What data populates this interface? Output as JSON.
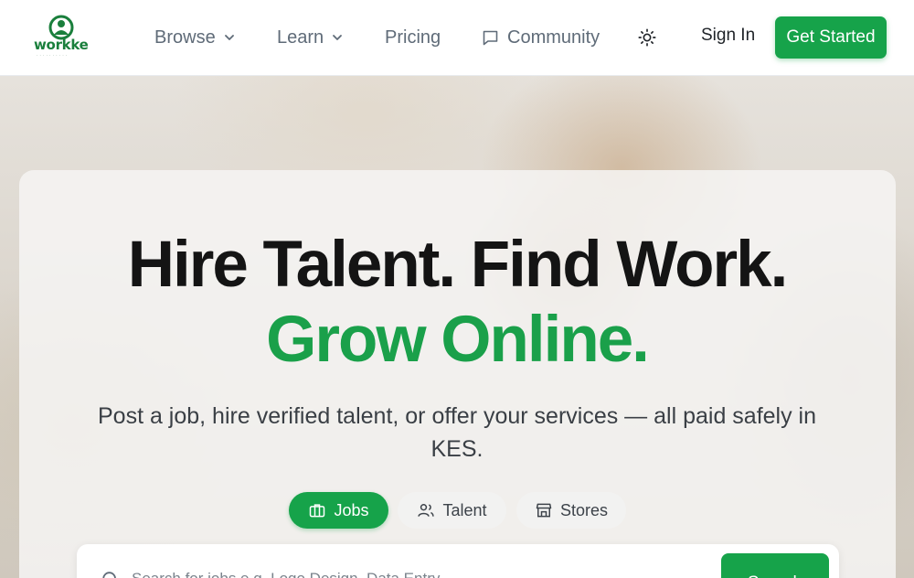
{
  "brand": {
    "name": "workke",
    "tagline": "· · · · · · · · · ·",
    "accent": "#16a34a",
    "accent_dark": "#1a7f3c"
  },
  "nav": {
    "items": [
      {
        "label": "Browse",
        "has_dropdown": true
      },
      {
        "label": "Learn",
        "has_dropdown": true
      },
      {
        "label": "Pricing",
        "has_dropdown": false
      },
      {
        "label": "Community",
        "icon": "message-square-icon"
      }
    ],
    "theme_toggle_icon": "sun-icon",
    "sign_in": "Sign In",
    "get_started": "Get Started"
  },
  "hero": {
    "headline_line1": "Hire Talent. Find Work.",
    "headline_line2": "Grow Online.",
    "subheadline": "Post a job, hire verified talent, or offer your services — all paid safely in KES.",
    "headline_color": "#141414",
    "highlight_color": "#1aa04a"
  },
  "tabs": [
    {
      "label": "Jobs",
      "icon": "briefcase-icon",
      "active": true
    },
    {
      "label": "Talent",
      "icon": "users-icon",
      "active": false
    },
    {
      "label": "Stores",
      "icon": "store-icon",
      "active": false
    }
  ],
  "search": {
    "placeholder": "Search for jobs e.g. Logo Design, Data Entry...",
    "button_label": "Search"
  }
}
